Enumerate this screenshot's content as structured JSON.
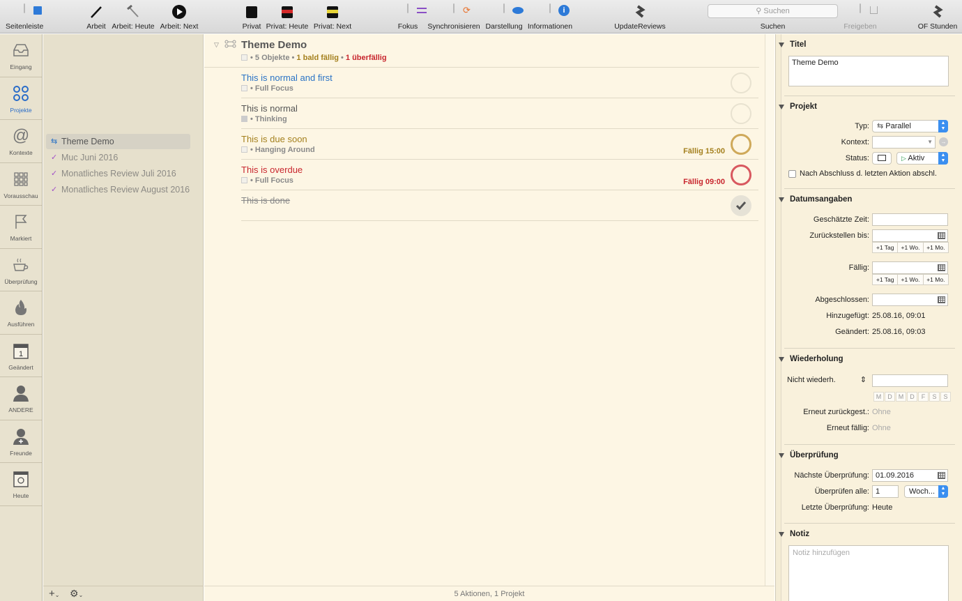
{
  "toolbar": {
    "sidebar_toggle": "Seitenleiste",
    "perspectives": [
      {
        "label": "Arbeit",
        "icon": "pen-icon"
      },
      {
        "label": "Arbeit: Heute",
        "icon": "hammer-icon"
      },
      {
        "label": "Arbeit: Next",
        "icon": "play-icon"
      },
      {
        "label": "Privat",
        "icon": "book-black-icon"
      },
      {
        "label": "Privat: Heute",
        "icon": "book-red-icon"
      },
      {
        "label": "Privat: Next",
        "icon": "book-yellow-icon"
      }
    ],
    "focus": "Fokus",
    "sync": "Synchronisieren",
    "view": "Darstellung",
    "info": "Informationen",
    "update_reviews": "UpdateReviews",
    "search_placeholder": "Suchen",
    "search_label": "Suchen",
    "share": "Freigeben",
    "of_hours": "OF Stunden"
  },
  "nav": [
    {
      "label": "Eingang",
      "icon": "inbox-icon"
    },
    {
      "label": "Projekte",
      "icon": "projects-icon",
      "active": true
    },
    {
      "label": "Kontexte",
      "icon": "at-icon"
    },
    {
      "label": "Vorausschau",
      "icon": "grid-icon"
    },
    {
      "label": "Markiert",
      "icon": "flag-icon"
    },
    {
      "label": "Überprüfung",
      "icon": "coffee-icon"
    },
    {
      "label": "Ausführen",
      "icon": "fire-icon"
    },
    {
      "label": "Geändert",
      "icon": "calendar-icon"
    },
    {
      "label": "ANDERE",
      "icon": "person-icon"
    },
    {
      "label": "Freunde",
      "icon": "person-plus-icon"
    },
    {
      "label": "Heute",
      "icon": "today-icon"
    }
  ],
  "sidebar": {
    "items": [
      {
        "label": "Theme Demo",
        "selected": true
      },
      {
        "label": "Muc Juni 2016"
      },
      {
        "label": "Monatliches Review Juli 2016"
      },
      {
        "label": "Monatliches Review August 2016"
      }
    ]
  },
  "project": {
    "title": "Theme Demo",
    "count": "5 Objekte",
    "due_soon": "1 bald fällig",
    "overdue": "1 überfällig"
  },
  "tasks": [
    {
      "title": "This is normal and first",
      "context": "Full Focus",
      "due": "",
      "color": "#2a73c5"
    },
    {
      "title": "This is normal",
      "context": "Thinking",
      "due": "",
      "color": "#555555"
    },
    {
      "title": "This is due soon",
      "context": "Hanging Around",
      "due": "Fällig 15:00",
      "color": "#a4801e"
    },
    {
      "title": "This is overdue",
      "context": "Full Focus",
      "due": "Fällig 09:00",
      "color": "#c8262e"
    },
    {
      "title": "This is done",
      "context": "",
      "due": "",
      "color": "#8a8a8a"
    }
  ],
  "status_bar": "5 Aktionen, 1 Projekt",
  "inspector": {
    "title_section": "Titel",
    "title_value": "Theme Demo",
    "project_section": "Projekt",
    "type_label": "Typ:",
    "type_value": "Parallel",
    "context_label": "Kontext:",
    "status_label": "Status:",
    "status_value": "Aktiv",
    "complete_checkbox": "Nach Abschluss d. letzten Aktion abschl.",
    "dates_section": "Datumsangaben",
    "estimate_label": "Geschätzte Zeit:",
    "defer_label": "Zurückstellen bis:",
    "due_label": "Fällig:",
    "completed_label": "Abgeschlossen:",
    "added_label": "Hinzugefügt:",
    "added_value": "25.08.16, 09:01",
    "changed_label": "Geändert:",
    "changed_value": "25.08.16, 09:03",
    "quick": [
      "+1 Tag",
      "+1 Wo.",
      "+1 Mo."
    ],
    "repeat_section": "Wiederholung",
    "repeat_value": "Nicht wiederh.",
    "days": [
      "M",
      "D",
      "M",
      "D",
      "F",
      "S",
      "S"
    ],
    "redefer_label": "Erneut zurückgest.:",
    "redefer_value": "Ohne",
    "redue_label": "Erneut fällig:",
    "redue_value": "Ohne",
    "review_section": "Überprüfung",
    "next_review_label": "Nächste Überprüfung:",
    "next_review_value": "01.09.2016",
    "review_every_label": "Überprüfen alle:",
    "review_every_value": "1",
    "review_unit": "Woch...",
    "last_review_label": "Letzte Überprüfung:",
    "last_review_value": "Heute",
    "note_section": "Notiz",
    "note_placeholder": "Notiz hinzufügen"
  }
}
